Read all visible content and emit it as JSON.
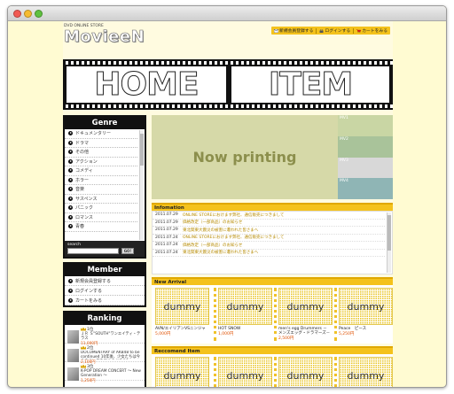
{
  "header": {
    "tagline": "DVD ONLINE STORE",
    "logo": "MovieeN",
    "nav": [
      {
        "label": "新規会員登録する"
      },
      {
        "label": "ログインする"
      },
      {
        "label": "カートをみる"
      }
    ]
  },
  "film": {
    "frame1": "HOME",
    "frame2": "ITEM"
  },
  "genre": {
    "title": "Genre",
    "items": [
      "ドキュメンタリー",
      "ドラマ",
      "その他",
      "アクション",
      "コメディ",
      "ホラー",
      "音楽",
      "サスペンス",
      "パニック",
      "ロマンス",
      "青春"
    ],
    "search_label": "search",
    "go_label": "GO!"
  },
  "member": {
    "title": "Member",
    "items": [
      "新規会員登録する",
      "ログインする",
      "カートをみる"
    ]
  },
  "ranking": {
    "title": "Ranking",
    "items": [
      {
        "rank": "1位",
        "title": "ＪＲ Ｓ\"SOUTH\"ワンエイティ・テラス",
        "price": "11,000円"
      },
      {
        "rank": "2位",
        "title": "DOCUMENTARY of AKB48 to be continued 10年後、少女たちは今の自分に何を思うのだろう？",
        "price": "2,100円"
      },
      {
        "rank": "3位",
        "title": "K-POP DREAM CONCERT ～ New Generation ～",
        "price": "1,250円"
      }
    ]
  },
  "banner": {
    "text": "Now printing",
    "mv": [
      "MV1",
      "MV2",
      "MV3",
      "MV4"
    ],
    "colors": [
      "#c9d6a4",
      "#a9c39a",
      "#d8d8d8",
      "#8fb5b5"
    ]
  },
  "infomation": {
    "title": "Infomation",
    "rows": [
      {
        "date": "2011.07.29",
        "text": "ONLINE STOREにおけます弊社、通信販売につきまして"
      },
      {
        "date": "2011.07.29",
        "text": "価格改定（一部商品）のお知らせ"
      },
      {
        "date": "2011.07.29",
        "text": "東北関東大震災の被害に遭われた皆さまへ"
      },
      {
        "date": "2011.07.24",
        "text": "ONLINE STOREにおけます弊社、通信販売につきまして"
      },
      {
        "date": "2011.07.24",
        "text": "価格改定（一部商品）のお知らせ"
      },
      {
        "date": "2011.07.24",
        "text": "東北関東大震災の被害に遭われた皆さまへ"
      }
    ]
  },
  "new_arrival": {
    "title": "New Arrival",
    "items": [
      {
        "img": "dummy",
        "title": "AVN/エイリアンVSニンジャ",
        "price": "5,000円"
      },
      {
        "img": "dummy",
        "title": "HOT SNOW",
        "price": "1,000円"
      },
      {
        "img": "dummy",
        "title": "men's egg Drummers －メンズエッグ・ドラマーズ－",
        "price": "2,500円"
      },
      {
        "img": "dummy",
        "title": "Peace　ピース",
        "price": "5,250円"
      }
    ]
  },
  "recommend": {
    "title": "Reccomend Item",
    "items": [
      {
        "img": "dummy"
      },
      {
        "img": "dummy"
      },
      {
        "img": "dummy"
      },
      {
        "img": "dummy"
      }
    ]
  }
}
